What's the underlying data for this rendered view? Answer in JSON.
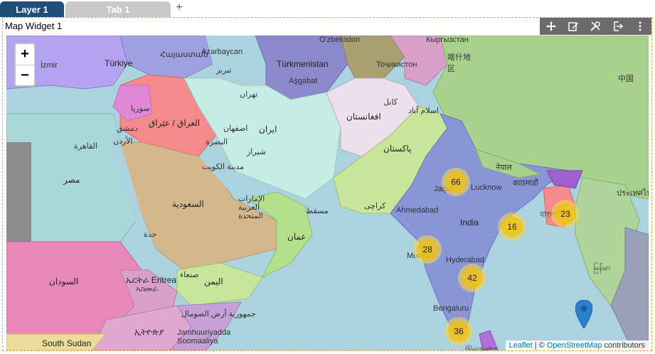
{
  "tabs": {
    "layer": "Layer 1",
    "tab": "Tab 1",
    "add": "+"
  },
  "widget": {
    "title": "Map Widget 1",
    "toolbar": [
      "move-icon",
      "edit-icon",
      "tools-icon",
      "export-icon",
      "more-icon"
    ]
  },
  "map": {
    "zoom_in": "+",
    "zoom_out": "−",
    "labels": {
      "armenia": "Հայաստան",
      "azerbaijan": "Azərbaycan",
      "izmir": "İzmir",
      "turkey": "Türkiye",
      "turkmenistan": "Türkmenistan",
      "ashgabat": "Aşgabat",
      "uzbekistan": "O'zbekiston",
      "kyrgyzstan": "Кыргызстан",
      "tajikistan": "Тоҷикистон",
      "kashgar": "喀什地区",
      "china": "中国",
      "tabriz": "تبریز",
      "tehran": "تهران",
      "syria": "سوريا",
      "damascus": "دمشق",
      "iraq": "العراق / عێراق",
      "isfahan": "اصفهان",
      "iran": "ایران",
      "kabul": "کابل",
      "afghanistan": "افغانستان",
      "islamabad": "اسلام آباد",
      "pakistan": "پاکستان",
      "shiraz": "شیراز",
      "basra": "البصرة",
      "jordan": "الأردن",
      "cairo": "القاهرة",
      "kuwait": "مدينة الكويت",
      "egypt": "مصر",
      "saudi": "السعودية",
      "uae": "الإمارات العربية المتحدة",
      "muscat": "مسقط",
      "karachi": "کراچی",
      "oman": "عمان",
      "jeddah": "جدة",
      "nepal": "नेपाल",
      "kathmandu": "काठमाडौं",
      "jaipur": "Jaipur",
      "lucknow": "Lucknow",
      "ahmedabad": "Ahmedabad",
      "india": "India",
      "mumbai": "Mumbai",
      "hyderabad": "Hyderabad",
      "bengaluru": "Bengaluru",
      "bangladesh": "বাংলাদেশ",
      "myanmar": "မြန်မာ",
      "thailand": "ประเทศไทย",
      "sudan": "السودان",
      "eritrea": "ኤርትራ Eritrea",
      "asmara": "ኣስመራ",
      "sanaa": "صنعاء",
      "yemen": "اليمن",
      "somalia": "جمهورية أرض الصومال",
      "somalia2": "Jamhuuriyadda Soomaaliya",
      "ethiopia": "ኢትዮጵያ",
      "south_sudan": "South Sudan",
      "sri_lanka": "இலங்கை"
    },
    "clusters": [
      {
        "id": "jaipur",
        "count": "66"
      },
      {
        "id": "bangladesh",
        "count": "23"
      },
      {
        "id": "central",
        "count": "16"
      },
      {
        "id": "mumbai",
        "count": "28"
      },
      {
        "id": "hyderabad",
        "count": "42"
      },
      {
        "id": "bengaluru",
        "count": "36"
      }
    ],
    "attribution": {
      "leaflet": "Leaflet",
      "separator": "| ©",
      "osm": "OpenStreetMap",
      "contributors": "contributors"
    }
  }
}
